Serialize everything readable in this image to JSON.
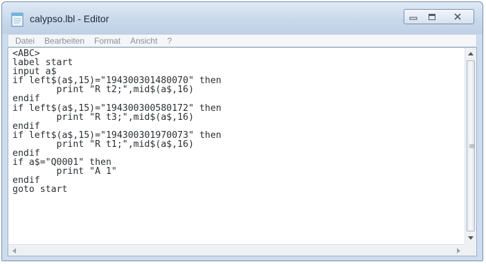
{
  "window": {
    "title": "calypso.lbl - Editor",
    "icons": {
      "app": "notepad-icon",
      "minimize": "minimize-icon",
      "maximize": "maximize-icon",
      "close": "close-icon"
    }
  },
  "menu": {
    "items": [
      "Datei",
      "Bearbeiten",
      "Format",
      "Ansicht",
      "?"
    ]
  },
  "editor": {
    "lines": [
      "<ABC>",
      "label start",
      "input a$",
      "if left$(a$,15)=\"194300301480070\" then",
      "        print \"R t2;\",mid$(a$,16)",
      "endif",
      "if left$(a$,15)=\"194300300580172\" then",
      "        print \"R t3;\",mid$(a$,16)",
      "endif",
      "if left$(a$,15)=\"194300301970073\" then",
      "        print \"R t1;\",mid$(a$,16)",
      "endif",
      "if a$=\"Q0001\" then",
      "        print \"A 1\"",
      "endif",
      "goto start"
    ]
  },
  "colors": {
    "titlebar": "#c9d9ec",
    "text": "#2b2f33",
    "menu_text": "#8a8f95"
  }
}
